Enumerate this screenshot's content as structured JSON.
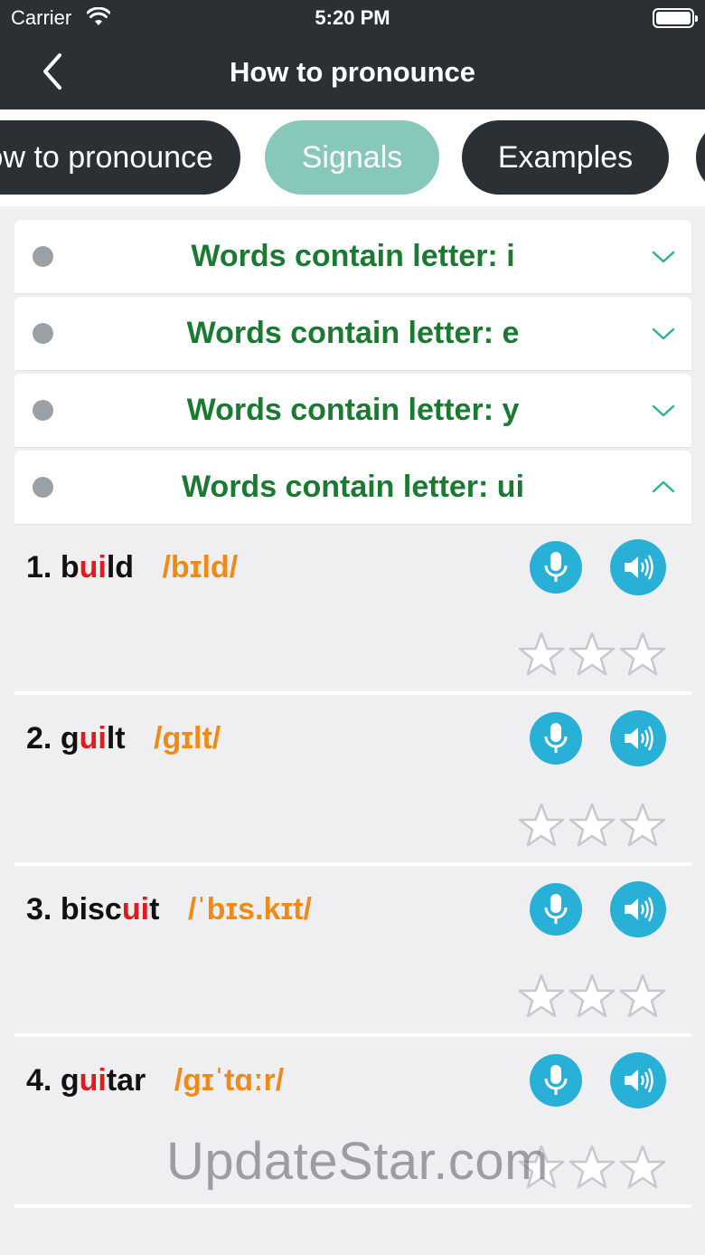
{
  "status_bar": {
    "carrier": "Carrier",
    "time": "5:20 PM"
  },
  "nav": {
    "title": "How to pronounce"
  },
  "tabs": [
    {
      "label": "How to pronounce",
      "active": false
    },
    {
      "label": "Signals",
      "active": true
    },
    {
      "label": "Examples",
      "active": false
    },
    {
      "label": "",
      "active": false
    }
  ],
  "groups": [
    {
      "title": "Words contain letter: i",
      "expanded": false
    },
    {
      "title": "Words contain letter: e",
      "expanded": false
    },
    {
      "title": "Words contain letter: y",
      "expanded": false
    },
    {
      "title": "Words contain letter: ui",
      "expanded": true
    }
  ],
  "words": [
    {
      "num": "1.",
      "pre": "b",
      "hl": "ui",
      "post": "ld",
      "ipa": "/bɪld/",
      "rating": 0
    },
    {
      "num": "2.",
      "pre": "g",
      "hl": "ui",
      "post": "lt",
      "ipa": "/ɡɪlt/",
      "rating": 0
    },
    {
      "num": "3.",
      "pre": "bisc",
      "hl": "ui",
      "post": "t",
      "ipa": "/ˈbɪs.kɪt/",
      "rating": 0
    },
    {
      "num": "4.",
      "pre": "g",
      "hl": "ui",
      "post": "tar",
      "ipa": "/ɡɪˈtɑːr/",
      "rating": 0
    }
  ],
  "colors": {
    "header": "#2b3035",
    "tab_active": "#88c8bb",
    "group_title": "#1b7a32",
    "highlight": "#e01b1b",
    "ipa": "#f08a16",
    "action_button": "#29b0d6"
  },
  "icons": [
    "back-arrow-icon",
    "wifi-icon",
    "battery-icon",
    "chevron-down-icon",
    "chevron-up-icon",
    "microphone-icon",
    "speaker-icon",
    "star-icon"
  ],
  "watermark": "UpdateStar.com"
}
